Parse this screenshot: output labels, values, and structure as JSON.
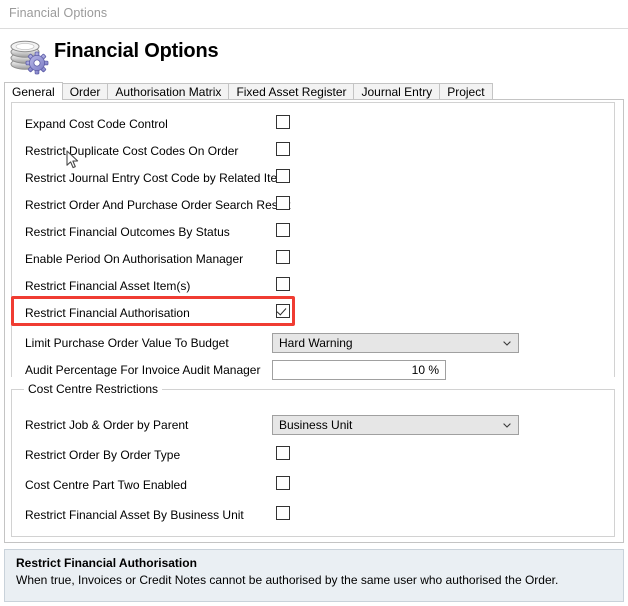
{
  "window": {
    "breadcrumb_title": "Financial Options"
  },
  "header": {
    "title": "Financial Options",
    "icon": "database-gear-icon"
  },
  "tabs": [
    {
      "label": "General",
      "selected": true
    },
    {
      "label": "Order",
      "selected": false
    },
    {
      "label": "Authorisation Matrix",
      "selected": false
    },
    {
      "label": "Fixed Asset Register",
      "selected": false
    },
    {
      "label": "Journal Entry",
      "selected": false
    },
    {
      "label": "Project",
      "selected": false
    }
  ],
  "general": {
    "options": [
      {
        "label": "Expand Cost Code Control",
        "checked": false
      },
      {
        "label": "Restrict Duplicate Cost Codes On Order",
        "checked": false
      },
      {
        "label": "Restrict Journal Entry Cost Code by Related Item",
        "checked": false
      },
      {
        "label": "Restrict Order And Purchase Order Search Result",
        "checked": false
      },
      {
        "label": "Restrict Financial Outcomes By Status",
        "checked": false
      },
      {
        "label": "Enable Period On Authorisation Manager",
        "checked": false
      },
      {
        "label": "Restrict Financial Asset Item(s)",
        "checked": false
      },
      {
        "label": "Restrict Financial Authorisation",
        "checked": true,
        "highlighted": true
      }
    ],
    "limit_purchase_order": {
      "label": "Limit Purchase Order Value To Budget",
      "value": "Hard Warning"
    },
    "audit_percentage": {
      "label": "Audit Percentage For Invoice Audit Manager",
      "value": "10 %"
    }
  },
  "cost_centre": {
    "legend": "Cost Centre Restrictions",
    "restrict_job_order": {
      "label": "Restrict Job & Order by Parent",
      "value": "Business Unit"
    },
    "options": [
      {
        "label": "Restrict Order By Order Type",
        "checked": false
      },
      {
        "label": "Cost Centre Part Two Enabled",
        "checked": false
      },
      {
        "label": "Restrict Financial Asset By Business Unit",
        "checked": false
      }
    ]
  },
  "description": {
    "title": "Restrict Financial Authorisation",
    "body": "When true, Invoices or Credit Notes cannot be authorised by the same user who authorised the Order."
  },
  "colors": {
    "highlight": "#f03c32",
    "panel_bg": "#eaeff3",
    "breadcrumb_text": "#9a9a9a"
  }
}
